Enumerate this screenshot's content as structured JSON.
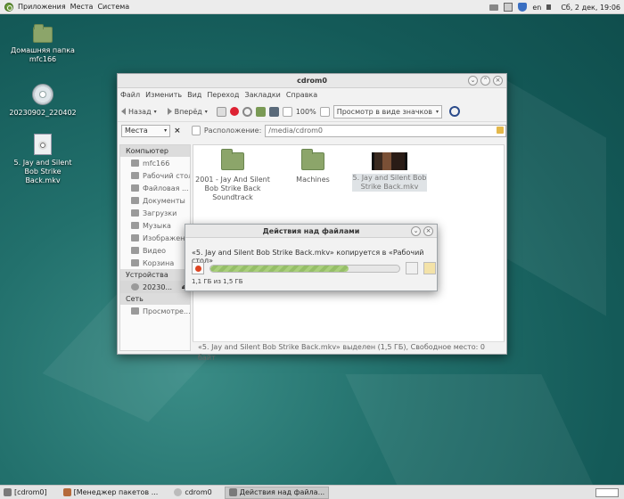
{
  "top_panel": {
    "menus": [
      "Приложения",
      "Места",
      "Система"
    ],
    "keyboard_layout": "en",
    "clock": "Сб, 2 дек, 19:06"
  },
  "desktop": {
    "icons": [
      {
        "label": "Домашняя папка mfc166",
        "icon": "home-folder-icon"
      },
      {
        "label": "20230902_220402",
        "icon": "optical-disc-icon"
      },
      {
        "label": "5. Jay and Silent Bob Strike Back.mkv",
        "icon": "video-file-icon"
      }
    ]
  },
  "file_manager": {
    "title": "cdrom0",
    "menu": [
      "Файл",
      "Изменить",
      "Вид",
      "Переход",
      "Закладки",
      "Справка"
    ],
    "toolbar": {
      "back": "Назад",
      "forward": "Вперёд",
      "zoom": "100%",
      "view_mode": "Просмотр в виде значков"
    },
    "places_select": "Места",
    "location_label": "Расположение:",
    "location_value": "/media/cdrom0",
    "sidebar": {
      "computer_header": "Компьютер",
      "computer_items": [
        "mfc166",
        "Рабочий стол",
        "Файловая ...",
        "Документы",
        "Загрузки",
        "Музыка",
        "Изображен...",
        "Видео",
        "Корзина"
      ],
      "devices_header": "Устройства",
      "devices_items": [
        "20230..."
      ],
      "network_header": "Сеть",
      "network_items": [
        "Просмотре..."
      ]
    },
    "items": [
      {
        "label": "2001 - Jay And Silent Bob Strike Back Soundtrack",
        "type": "folder"
      },
      {
        "label": "Machines",
        "type": "folder"
      },
      {
        "label": "5. Jay and Silent Bob Strike Back.mkv",
        "type": "video",
        "selected": true
      }
    ],
    "status": "«5. Jay and Silent Bob Strike Back.mkv» выделен (1,5 ГБ), Свободное место: 0 байт"
  },
  "ops_dialog": {
    "title": "Действия над файлами",
    "message": "«5. Jay and Silent Bob Strike Back.mkv» копируется в «Рабочий стол»",
    "progress": 0.73,
    "size_text": "1,1 ГБ из 1,5 ГБ"
  },
  "taskbar": {
    "tasks": [
      "[cdrom0]",
      "[Менеджер пакетов ...",
      "cdrom0",
      "Действия над файла..."
    ]
  }
}
